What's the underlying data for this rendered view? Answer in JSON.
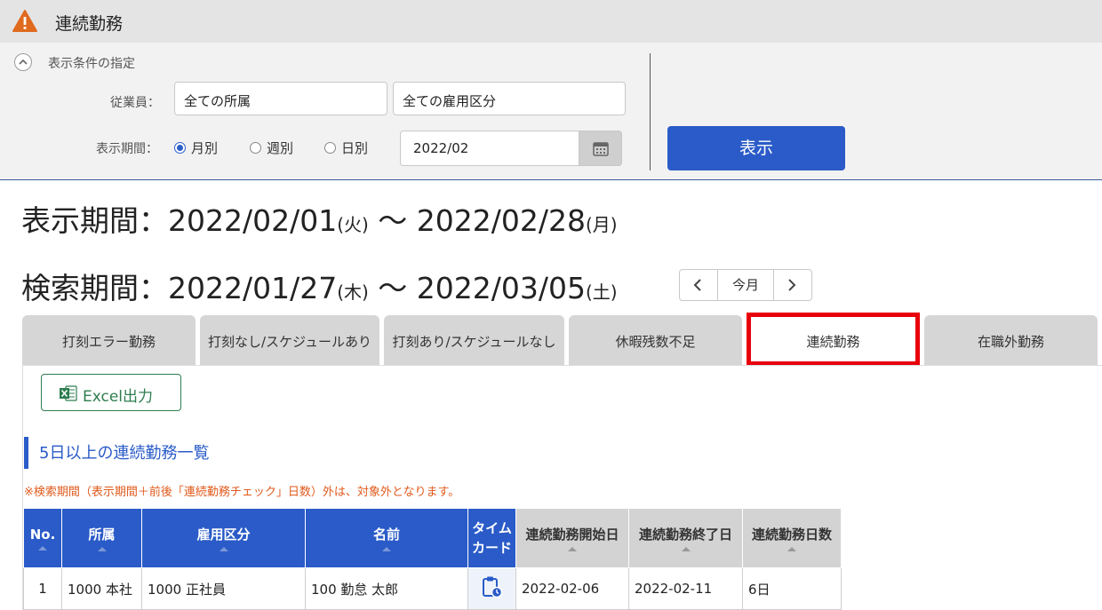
{
  "header": {
    "title": "連続勤務",
    "icon": "warning-icon"
  },
  "filter": {
    "toggle_label": "表示条件の指定",
    "employee_label": "従業員：",
    "affiliation_value": "全ての所属",
    "employment_type_value": "全ての雇用区分",
    "period_label": "表示期間：",
    "period_options": [
      {
        "label": "月別",
        "selected": true
      },
      {
        "label": "週別",
        "selected": false
      },
      {
        "label": "日別",
        "selected": false
      }
    ],
    "date_value": "2022/02",
    "show_button": "表示"
  },
  "display_period": {
    "label": "表示期間：",
    "start": "2022/02/01",
    "start_day": "(火)",
    "sep": " 〜 ",
    "end": "2022/02/28",
    "end_day": "(月)"
  },
  "search_period": {
    "label": "検索期間：",
    "start": "2022/01/27",
    "start_day": "(木)",
    "sep": " 〜 ",
    "end": "2022/03/05",
    "end_day": "(土)"
  },
  "nav": {
    "prev": "‹",
    "current": "今月",
    "next": "›"
  },
  "tabs": [
    {
      "label": "打刻エラー勤務",
      "active": false
    },
    {
      "label": "打刻なし/スケジュールあり",
      "active": false
    },
    {
      "label": "打刻あり/スケジュールなし",
      "active": false
    },
    {
      "label": "休暇残数不足",
      "active": false
    },
    {
      "label": "連続勤務",
      "active": true
    },
    {
      "label": "在職外勤務",
      "active": false
    }
  ],
  "excel_button": "Excel出力",
  "section_title": "5日以上の連続勤務一覧",
  "note": "※検索期間（表示期間＋前後「連続勤務チェック」日数）外は、対象外となります。",
  "table": {
    "columns": [
      "No.",
      "所属",
      "雇用区分",
      "名前",
      "タイム\nカード",
      "連続勤務開始日",
      "連続勤務終了日",
      "連続勤務日数"
    ],
    "rows": [
      {
        "no": "1",
        "affiliation": "1000 本社",
        "type": "1000 正社員",
        "name": "100 勤怠 太郎",
        "start": "2022-02-06",
        "end": "2022-02-11",
        "days": "6日"
      }
    ]
  },
  "colors": {
    "accent": "#2a5bc8",
    "highlight": "#e8000a",
    "warning": "#e06a1e",
    "excel": "#2e7d4f"
  }
}
